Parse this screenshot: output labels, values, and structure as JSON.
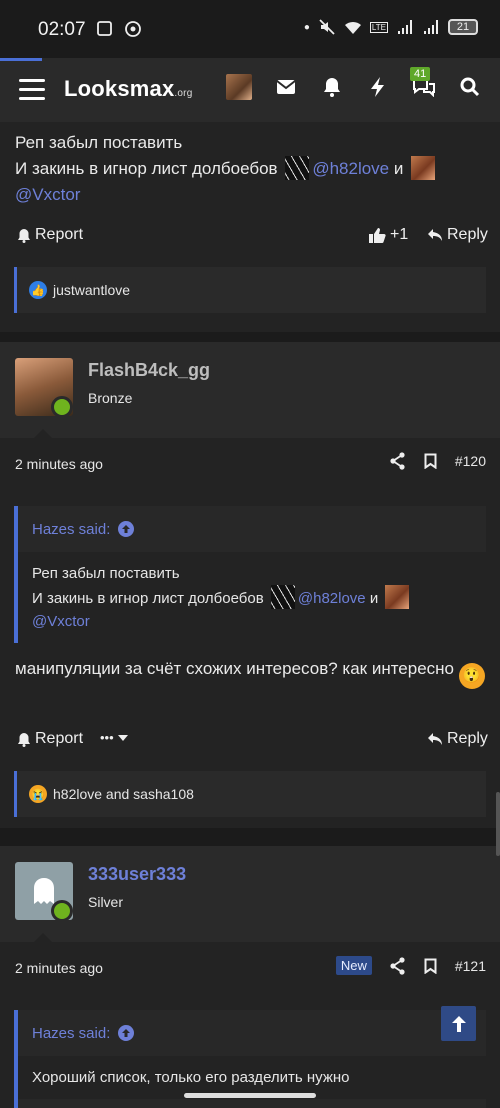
{
  "status": {
    "time": "02:07",
    "battery": "21"
  },
  "nav": {
    "logo_main": "Looksmax",
    "logo_suffix": ".org",
    "alerts_count": "41"
  },
  "post_top": {
    "line1": "Реп забыл поставить",
    "line2": "И закинь в игнор лист долбоебов",
    "mention1": "@h82love",
    "and": "и",
    "mention2": "@Vxctor",
    "report": "Report",
    "like_count": "+1",
    "reply": "Reply",
    "reactions_text": "justwantlove"
  },
  "post_120": {
    "username": "FlashB4ck_gg",
    "rank": "Bronze",
    "time": "2 minutes ago",
    "number": "#120",
    "quote_author": "Hazes said:",
    "quote_line1": "Реп забыл поставить",
    "quote_line2": "И закинь в игнор лист долбоебов",
    "quote_mention1": "@h82love",
    "quote_and": "и",
    "quote_mention2": "@Vxctor",
    "body": "манипуляции за счёт схожих интересов? как интересно",
    "report": "Report",
    "more": "•••",
    "reply": "Reply",
    "reactions_text": "h82love and sasha108"
  },
  "post_121": {
    "username": "333user333",
    "rank": "Silver",
    "time": "2 minutes ago",
    "new_label": "New",
    "number": "#121",
    "quote_author": "Hazes said:",
    "quote_partial": "Хороший список, только его разделить нужно"
  },
  "colors": {
    "accent": "#4a6fd6",
    "mention": "#6e80d8",
    "online": "#6fb31e",
    "badge": "#5fa82a"
  }
}
